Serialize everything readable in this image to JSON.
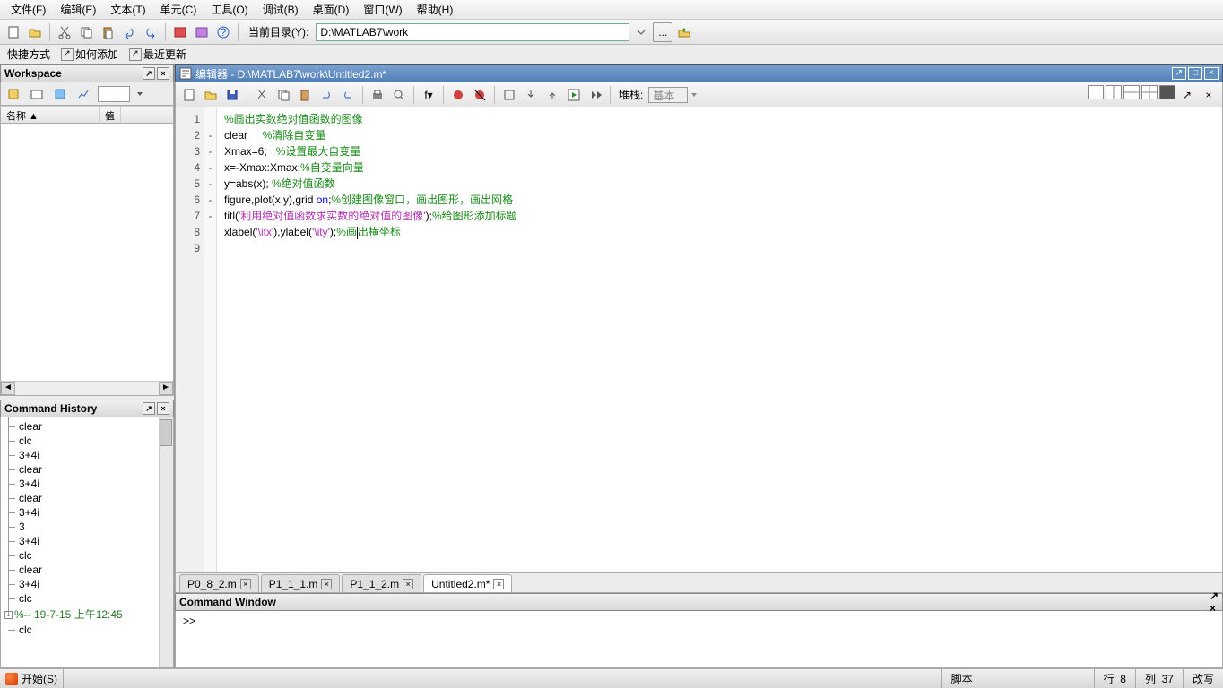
{
  "menu": {
    "file": "文件(F)",
    "edit": "编辑(E)",
    "text": "文本(T)",
    "cell": "单元(C)",
    "tools": "工具(O)",
    "debug": "调试(B)",
    "desktop": "桌面(D)",
    "window": "窗口(W)",
    "help": "帮助(H)"
  },
  "curdir": {
    "label": "当前目录(Y):",
    "value": "D:\\MATLAB7\\work"
  },
  "shortcuts": {
    "s1": "快捷方式",
    "s2": "如何添加",
    "s3": "最近更新"
  },
  "workspace": {
    "title": "Workspace",
    "col1": "名称 ▲",
    "col2": "值"
  },
  "history": {
    "title": "Command History",
    "items": [
      "clear",
      "clc",
      "3+4i",
      "clear",
      "3+4i",
      "clear",
      "3+4i",
      "3",
      "3+4i",
      "clc",
      "clear",
      "3+4i",
      "clc"
    ],
    "date": "%-- 19-7-15  上午12:45",
    "last": "clc"
  },
  "editor": {
    "title": "编辑器 - D:\\MATLAB7\\work\\Untitled2.m*",
    "stack_label": "堆栈:",
    "stack_value": "基本",
    "lines": [
      {
        "n": "1",
        "dash": "",
        "code": [
          {
            "t": "cm",
            "v": "%画出实数绝对值函数的图像"
          }
        ]
      },
      {
        "n": "2",
        "dash": "-",
        "code": [
          {
            "t": "",
            "v": "clear     "
          },
          {
            "t": "cm",
            "v": "%清除自变量"
          }
        ]
      },
      {
        "n": "3",
        "dash": "-",
        "code": [
          {
            "t": "",
            "v": "Xmax=6;   "
          },
          {
            "t": "cm",
            "v": "%设置最大自变量"
          }
        ]
      },
      {
        "n": "4",
        "dash": "-",
        "code": [
          {
            "t": "",
            "v": "x=-Xmax:Xmax;"
          },
          {
            "t": "cm",
            "v": "%自变量向量"
          }
        ]
      },
      {
        "n": "5",
        "dash": "-",
        "code": [
          {
            "t": "",
            "v": "y=abs(x); "
          },
          {
            "t": "cm",
            "v": "%绝对值函数"
          }
        ]
      },
      {
        "n": "6",
        "dash": "-",
        "code": [
          {
            "t": "",
            "v": "figure,plot(x,y),grid "
          },
          {
            "t": "kw",
            "v": "on"
          },
          {
            "t": "",
            "v": ";"
          },
          {
            "t": "cm",
            "v": "%创建图像窗口，画出图形，画出网格"
          }
        ]
      },
      {
        "n": "7",
        "dash": "-",
        "code": [
          {
            "t": "",
            "v": "titl("
          },
          {
            "t": "str",
            "v": "'利用绝对值函数求实数的绝对值的图像'"
          },
          {
            "t": "",
            "v": ");"
          },
          {
            "t": "cm",
            "v": "%给图形添加标题"
          }
        ]
      },
      {
        "n": "8",
        "dash": "",
        "code": [
          {
            "t": "",
            "v": "xlabel("
          },
          {
            "t": "str",
            "v": "'\\itx'"
          },
          {
            "t": "",
            "v": "),ylabel("
          },
          {
            "t": "str",
            "v": "'\\ity'"
          },
          {
            "t": "",
            "v": ");"
          },
          {
            "t": "cm",
            "v": "%画"
          },
          {
            "t": "cur",
            "v": ""
          },
          {
            "t": "cm",
            "v": "出横坐标"
          }
        ]
      },
      {
        "n": "9",
        "dash": "",
        "code": []
      }
    ],
    "tabs": [
      {
        "label": "P0_8_2.m",
        "active": false
      },
      {
        "label": "P1_1_1.m",
        "active": false
      },
      {
        "label": "P1_1_2.m",
        "active": false
      },
      {
        "label": "Untitled2.m*",
        "active": true
      }
    ]
  },
  "cmd": {
    "title": "Command Window",
    "prompt": ">> "
  },
  "status": {
    "start": "开始(S)",
    "mode": "脚本",
    "line_lbl": "行",
    "line": "8",
    "col_lbl": "列",
    "col": "37",
    "ovr": "改写"
  }
}
